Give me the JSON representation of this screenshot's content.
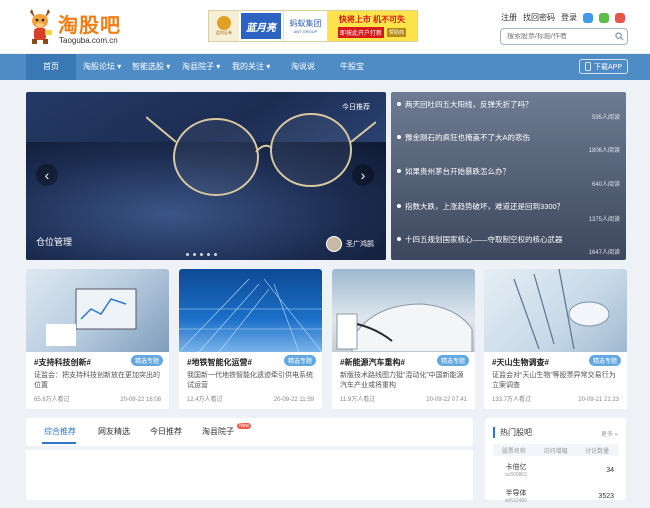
{
  "brand": {
    "name": "淘股吧",
    "domain": "Taoguba.com.cn"
  },
  "banner": {
    "logo1": "盈利证券",
    "logo2": "蓝月亮",
    "logo3": "蚂蚁集团",
    "logo3_sub": "ANT GROUP",
    "headline": "快将上市 机不可失",
    "cta": "即按此开户打新",
    "sponsor": "赞助商"
  },
  "header": {
    "register": "注册",
    "forgot": "找回密码",
    "login": "登录",
    "search_placeholder": "搜索股票/标题/作者"
  },
  "nav": {
    "items": [
      "首页",
      "淘股论坛",
      "智能选股",
      "淘县院子",
      "我的关注",
      "淘说说",
      "牛股宝"
    ],
    "download": "下载APP"
  },
  "hero": {
    "tag": "今日推荐",
    "caption": "仓位管理",
    "author": "圣广鸿鹄"
  },
  "hot_list": [
    {
      "title": "两天回吐四五大阳线，反弹夭折了吗？",
      "reads": "595人阅读"
    },
    {
      "title": "豫金刚石的疯狂也掩盖不了大A的悲伤",
      "reads": "1806人阅读"
    },
    {
      "title": "如果贵州茅台开始暴跌怎么办？",
      "reads": "640人阅读"
    },
    {
      "title": "指数大跌，上涨趋势破坏，难道还是回到3300？",
      "reads": "1375人阅读"
    },
    {
      "title": "十四五规划国家核心——夺取制空权的核心武器",
      "reads": "1647人阅读"
    }
  ],
  "cards": [
    {
      "title": "#支持科技创新#",
      "badge": "精选专题",
      "desc": "证监会：把支持科技创新放在更加突出的位置",
      "views": "65.6万人看过",
      "time": "20-09-22 16:08"
    },
    {
      "title": "#地铁智能化运营#",
      "badge": "精选专题",
      "desc": "我国新一代地铁智能化遗迹牵引供电系统试运营",
      "views": "12.4万人看过",
      "time": "20-09-22 11:59"
    },
    {
      "title": "#新能源汽车重构#",
      "badge": "精选专题",
      "desc": "新版技术路线图力挺“混动化”中国新能源汽车产业或将重构",
      "views": "11.9万人看过",
      "time": "20-09-22 07:41"
    },
    {
      "title": "#天山生物调查#",
      "badge": "精选专题",
      "desc": "证监会对“天山生物”等股票异常交易行为立案调查",
      "views": "133.7万人看过",
      "time": "20-09-21 21:23"
    }
  ],
  "tabs": {
    "items": [
      "综合推荐",
      "网友精选",
      "今日推荐",
      "淘县院子"
    ],
    "new_badge": "New"
  },
  "stocks": {
    "title": "热门股吧",
    "more": "更多 »",
    "columns": [
      "股票名称",
      "访问增幅",
      "讨论数量"
    ],
    "rows": [
      {
        "name": "卡倍亿",
        "code": "sz300863",
        "count": "34"
      },
      {
        "name": "半导体",
        "code": "sh512480",
        "count": "3523"
      }
    ]
  },
  "colors": {
    "brand_orange": "#f07e14",
    "nav_blue": "#4f8cc6",
    "accent_blue": "#2f77c5"
  }
}
